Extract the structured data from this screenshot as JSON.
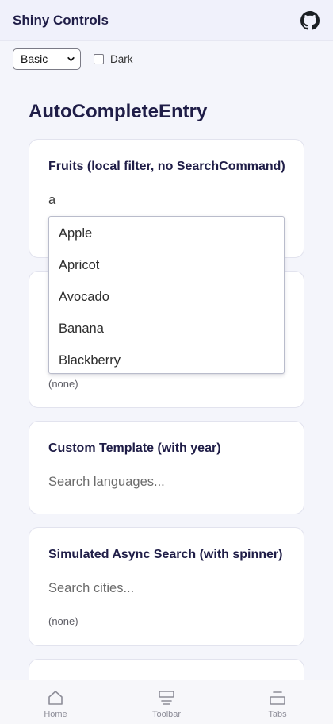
{
  "header": {
    "title": "Shiny Controls",
    "icon": "github-icon"
  },
  "controls": {
    "theme_select": {
      "value": "Basic"
    },
    "dark_toggle": {
      "label": "Dark",
      "checked": false
    }
  },
  "page": {
    "title": "AutoCompleteEntry"
  },
  "cards": {
    "fruits": {
      "title": "Fruits (local filter, no SearchCommand)",
      "entry_value": "a"
    },
    "second": {
      "selected": "(none)"
    },
    "custom_template": {
      "title": "Custom Template (with year)",
      "placeholder": "Search languages..."
    },
    "async": {
      "title": "Simulated Async Search (with spinner)",
      "placeholder": "Search cities...",
      "selected": "(none)"
    }
  },
  "suggestions": [
    "Apple",
    "Apricot",
    "Avocado",
    "Banana",
    "Blackberry"
  ],
  "tabbar": {
    "tabs": [
      {
        "label": "Home",
        "icon": "home-icon"
      },
      {
        "label": "Toolbar",
        "icon": "toolbar-icon"
      },
      {
        "label": "Tabs",
        "icon": "tabs-icon"
      }
    ]
  },
  "colors": {
    "background": "#f4f5fb",
    "header_bg": "#f0f1fb",
    "title_text": "#1f1d47",
    "card_border": "#e2e3ee",
    "tab_label": "#8d8d98"
  }
}
